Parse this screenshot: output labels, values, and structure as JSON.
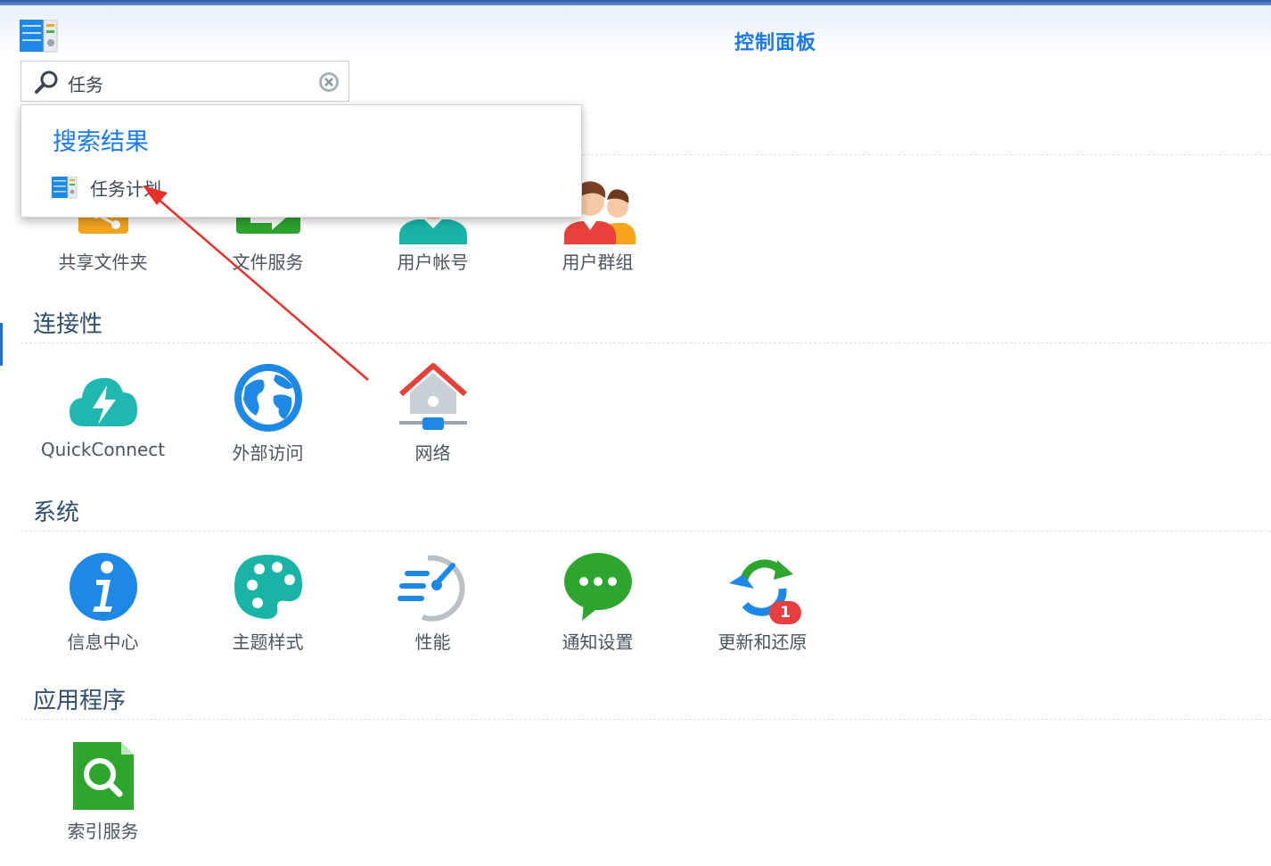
{
  "window": {
    "title": "控制面板",
    "app_icon": "control-panel-icon"
  },
  "search": {
    "value": "任务",
    "search_icon": "search-icon",
    "clear_icon": "clear-icon"
  },
  "search_results": {
    "title": "搜索结果",
    "items": [
      {
        "label": "任务计划",
        "icon": "task-scheduler-icon"
      }
    ]
  },
  "sections": [
    {
      "title": "",
      "items": [
        {
          "label": "共享文件夹",
          "icon": "shared-folder-icon"
        },
        {
          "label": "文件服务",
          "icon": "file-services-icon"
        },
        {
          "label": "用户帐号",
          "icon": "user-icon"
        },
        {
          "label": "用户群组",
          "icon": "user-group-icon"
        }
      ]
    },
    {
      "title": "连接性",
      "items": [
        {
          "label": "QuickConnect",
          "icon": "quickconnect-icon"
        },
        {
          "label": "外部访问",
          "icon": "external-access-icon"
        },
        {
          "label": "网络",
          "icon": "network-icon"
        }
      ]
    },
    {
      "title": "系统",
      "items": [
        {
          "label": "信息中心",
          "icon": "info-center-icon"
        },
        {
          "label": "主题样式",
          "icon": "theme-icon"
        },
        {
          "label": "性能",
          "icon": "performance-icon"
        },
        {
          "label": "通知设置",
          "icon": "notification-icon"
        },
        {
          "label": "更新和还原",
          "icon": "update-restore-icon",
          "badge": "1"
        }
      ]
    },
    {
      "title": "应用程序",
      "items": [
        {
          "label": "索引服务",
          "icon": "indexing-service-icon"
        }
      ]
    }
  ],
  "colors": {
    "accent": "#1a7ae8",
    "annotation_arrow": "#e8302a",
    "badge": "#e84040"
  }
}
